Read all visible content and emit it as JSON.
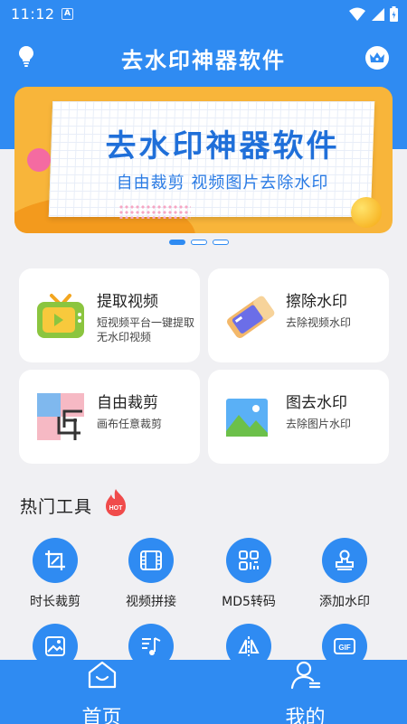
{
  "status": {
    "time": "11:12",
    "notif": "A"
  },
  "header": {
    "title": "去水印神器软件"
  },
  "banner": {
    "title": "去水印神器软件",
    "subtitle": "自由裁剪 视频图片去除水印"
  },
  "cards": [
    {
      "title": "提取视频",
      "desc": "短视频平台一键提取无水印视频"
    },
    {
      "title": "擦除水印",
      "desc": "去除视频水印"
    },
    {
      "title": "自由裁剪",
      "desc": "画布任意裁剪"
    },
    {
      "title": "图去水印",
      "desc": "去除图片水印"
    }
  ],
  "hot": {
    "title": "热门工具",
    "badge": "HOT"
  },
  "tools": [
    {
      "label": "时长裁剪",
      "icon": "crop-icon"
    },
    {
      "label": "视频拼接",
      "icon": "film-icon"
    },
    {
      "label": "MD5转码",
      "icon": "scan-icon"
    },
    {
      "label": "添加水印",
      "icon": "stamp-icon"
    },
    {
      "label": "",
      "icon": "image-icon"
    },
    {
      "label": "",
      "icon": "music-icon"
    },
    {
      "label": "",
      "icon": "mirror-icon"
    },
    {
      "label": "",
      "icon": "gif-icon"
    }
  ],
  "nav": {
    "home": "首页",
    "mine": "我的"
  },
  "colors": {
    "primary": "#2f8bf2",
    "background": "#f0f0f3"
  }
}
